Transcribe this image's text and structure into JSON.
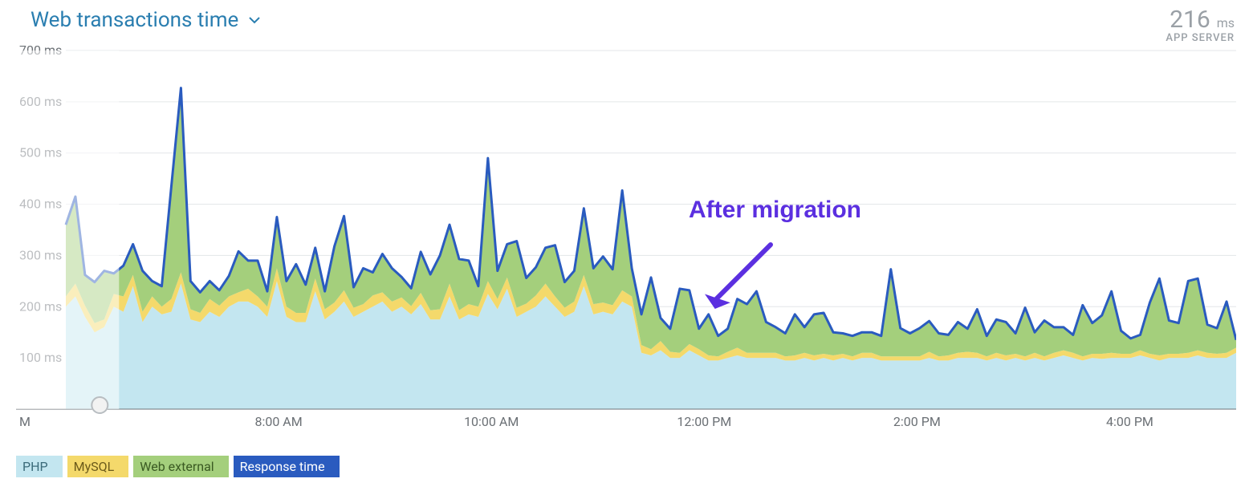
{
  "header": {
    "title": "Web transactions time",
    "readout": {
      "value": "216",
      "unit": " ms",
      "label": "APP SERVER"
    }
  },
  "annotation": {
    "text": "After migration"
  },
  "legend": [
    {
      "label": "PHP",
      "color": "#c3e6f0"
    },
    {
      "label": "MySQL",
      "color": "#f4d96b"
    },
    {
      "label": "Web external",
      "color": "#a4cf7c"
    },
    {
      "label": "Response time",
      "color": "#2a5bbf"
    }
  ],
  "colors": {
    "php": "#c3e6f0",
    "mysql": "#f4d96b",
    "web": "#a4cf7c",
    "respLine": "#2a5bbf",
    "respLineW": 3,
    "grid": "#e3e6e8",
    "axis": "#6e7378",
    "annot": "#5b2fe0"
  },
  "chart_data": {
    "type": "area",
    "title": "Web transactions time",
    "xlabel": "",
    "ylabel": "",
    "yunit": "ms",
    "ylim": [
      0,
      700
    ],
    "yticks": [
      100,
      200,
      300,
      400,
      500,
      600,
      700
    ],
    "x_start_hour": 6.0,
    "x_end_hour": 17.0,
    "x_ticks": [
      {
        "hour": 8,
        "label": "8:00 AM"
      },
      {
        "hour": 10,
        "label": "10:00 AM"
      },
      {
        "hour": 12,
        "label": "12:00 PM"
      },
      {
        "hour": 14,
        "label": "2:00 PM"
      },
      {
        "hour": 16,
        "label": "4:00 PM"
      }
    ],
    "left_edge_label": "M",
    "selection_faded_until_hour": 6.5,
    "series": [
      {
        "name": "PHP",
        "role": "stack",
        "values": [
          200,
          220,
          180,
          150,
          160,
          200,
          190,
          240,
          170,
          200,
          185,
          190,
          245,
          175,
          170,
          190,
          180,
          200,
          210,
          210,
          200,
          180,
          250,
          180,
          170,
          170,
          230,
          175,
          190,
          210,
          180,
          190,
          200,
          210,
          190,
          200,
          185,
          205,
          175,
          175,
          220,
          175,
          185,
          180,
          225,
          195,
          235,
          180,
          190,
          200,
          220,
          200,
          180,
          190,
          240,
          185,
          190,
          185,
          210,
          200,
          110,
          105,
          115,
          100,
          100,
          115,
          105,
          95,
          95,
          100,
          105,
          100,
          100,
          100,
          100,
          95,
          95,
          100,
          95,
          100,
          95,
          100,
          95,
          100,
          100,
          95,
          95,
          95,
          95,
          95,
          100,
          95,
          95,
          100,
          100,
          100,
          95,
          100,
          95,
          100,
          95,
          100,
          95,
          100,
          105,
          100,
          95,
          100,
          98,
          100,
          100,
          100,
          105,
          100,
          95,
          100,
          100,
          100,
          105,
          100,
          100,
          100,
          110
        ]
      },
      {
        "name": "MySQL",
        "role": "stack",
        "values": [
          20,
          25,
          22,
          18,
          15,
          25,
          30,
          22,
          20,
          20,
          15,
          25,
          22,
          20,
          18,
          25,
          22,
          20,
          18,
          25,
          20,
          20,
          25,
          20,
          18,
          18,
          25,
          20,
          18,
          22,
          18,
          15,
          22,
          18,
          20,
          18,
          16,
          22,
          18,
          20,
          25,
          18,
          20,
          20,
          25,
          20,
          22,
          18,
          16,
          22,
          25,
          20,
          18,
          20,
          22,
          20,
          18,
          18,
          22,
          20,
          15,
          12,
          18,
          12,
          10,
          12,
          12,
          10,
          8,
          12,
          15,
          10,
          10,
          10,
          10,
          8,
          10,
          10,
          10,
          8,
          10,
          8,
          8,
          10,
          10,
          8,
          8,
          8,
          8,
          8,
          12,
          8,
          10,
          10,
          12,
          10,
          8,
          10,
          10,
          8,
          8,
          10,
          8,
          10,
          10,
          10,
          8,
          8,
          10,
          10,
          8,
          8,
          10,
          8,
          10,
          8,
          8,
          10,
          10,
          10,
          8,
          10,
          10
        ]
      },
      {
        "name": "Web external",
        "role": "stack",
        "values": [
          140,
          170,
          60,
          80,
          95,
          40,
          60,
          60,
          80,
          30,
          40,
          220,
          360,
          55,
          40,
          35,
          30,
          40,
          80,
          55,
          70,
          30,
          100,
          50,
          95,
          55,
          60,
          35,
          110,
          145,
          40,
          70,
          45,
          75,
          65,
          40,
          35,
          80,
          70,
          105,
          115,
          100,
          85,
          40,
          240,
          55,
          65,
          130,
          50,
          55,
          70,
          100,
          50,
          60,
          130,
          70,
          90,
          70,
          195,
          55,
          60,
          140,
          45,
          45,
          125,
          105,
          40,
          80,
          40,
          45,
          95,
          95,
          120,
          60,
          50,
          45,
          80,
          50,
          80,
          80,
          45,
          40,
          40,
          40,
          40,
          40,
          170,
          55,
          45,
          55,
          60,
          45,
          40,
          60,
          45,
          85,
          40,
          65,
          65,
          40,
          95,
          40,
          70,
          50,
          45,
          35,
          100,
          60,
          75,
          120,
          45,
          30,
          30,
          100,
          150,
          65,
          60,
          140,
          140,
          55,
          50,
          100,
          25
        ]
      },
      {
        "name": "Response time",
        "role": "line",
        "values": [
          360,
          415,
          262,
          248,
          270,
          265,
          280,
          322,
          270,
          250,
          240,
          435,
          627,
          250,
          228,
          250,
          232,
          260,
          308,
          290,
          290,
          230,
          375,
          250,
          283,
          243,
          315,
          230,
          318,
          377,
          238,
          275,
          267,
          303,
          275,
          258,
          236,
          307,
          263,
          300,
          360,
          293,
          290,
          240,
          490,
          270,
          322,
          328,
          256,
          277,
          315,
          320,
          248,
          270,
          392,
          275,
          298,
          273,
          427,
          275,
          185,
          257,
          178,
          157,
          235,
          232,
          157,
          185,
          143,
          157,
          215,
          205,
          230,
          170,
          160,
          148,
          185,
          160,
          185,
          188,
          150,
          148,
          143,
          150,
          150,
          143,
          273,
          158,
          148,
          158,
          172,
          148,
          145,
          170,
          157,
          195,
          143,
          175,
          170,
          148,
          198,
          150,
          173,
          160,
          160,
          145,
          203,
          168,
          183,
          230,
          153,
          138,
          145,
          208,
          255,
          173,
          168,
          250,
          255,
          165,
          158,
          210,
          135
        ]
      }
    ]
  }
}
